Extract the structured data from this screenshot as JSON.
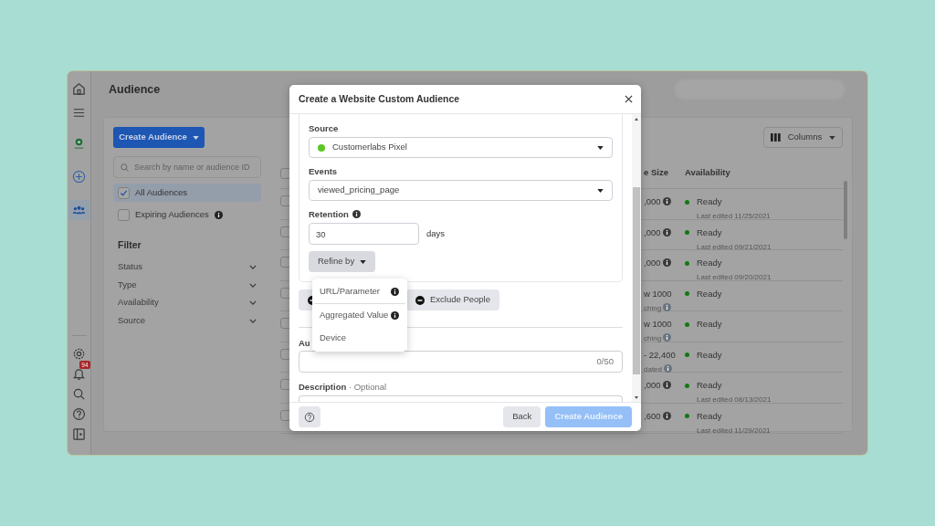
{
  "app": {
    "title": "Audience",
    "rail": {
      "items": [
        {
          "selected": false
        },
        {
          "selected": false
        },
        {
          "selected": false
        },
        {
          "selected": false
        },
        {
          "selected": true
        }
      ],
      "notification_count": "94"
    },
    "create_button": "Create Audience",
    "search": {
      "placeholder": "Search by name or audience ID"
    },
    "views": [
      {
        "label": "All Audiences",
        "selected": true
      },
      {
        "label": "Expiring Audiences",
        "selected": false,
        "info": true
      }
    ],
    "filter": {
      "title": "Filter",
      "items": [
        "Status",
        "Type",
        "Availability",
        "Source"
      ]
    },
    "columns_button": "Columns",
    "table": {
      "select_all": {
        "checked": false
      },
      "columns": [
        "e Size",
        "Availability"
      ],
      "rows": [
        {
          "checked": false,
          "size": ",000",
          "info": true,
          "status": "Ready",
          "edited": "Last edited 11/25/2021"
        },
        {
          "checked": false,
          "size": ",000",
          "info": true,
          "status": "Ready",
          "edited": "Last edited 09/21/2021"
        },
        {
          "checked": false,
          "size": ",000",
          "info": true,
          "status": "Ready",
          "edited": "Last edited 09/20/2021"
        },
        {
          "checked": false,
          "size": "w 1000",
          "note": "ching",
          "info": true,
          "status": "Ready"
        },
        {
          "checked": false,
          "size": "w 1000",
          "note": "ching",
          "info": true,
          "status": "Ready"
        },
        {
          "checked": false,
          "size": "- 22,400",
          "note": "dated",
          "info": true,
          "status": "Ready"
        },
        {
          "checked": false,
          "size": ",000",
          "info": true,
          "status": "Ready",
          "edited": "Last edited 08/13/2021"
        },
        {
          "checked": false,
          "size": ",600",
          "info": true,
          "status": "Ready",
          "edited": "Last edited 11/29/2021"
        }
      ]
    }
  },
  "modal": {
    "title": "Create a Website Custom Audience",
    "source": {
      "label": "Source",
      "value": "Customerlabs Pixel"
    },
    "events": {
      "label": "Events",
      "value": "viewed_pricing_page"
    },
    "retention": {
      "label": "Retention",
      "value": "30",
      "unit": "days"
    },
    "refine_button": "Refine by",
    "refine_menu": [
      {
        "label": "URL/Parameter",
        "info": true
      },
      {
        "label": "Aggregated Value",
        "info": true
      },
      {
        "label": "Device",
        "info": false
      }
    ],
    "exclude_button": "Exclude People",
    "name": {
      "label": "Au",
      "counter": "0/50"
    },
    "description": {
      "label": "Description",
      "optional": "· Optional"
    },
    "back_button": "Back",
    "create_button": {
      "label": "Create Audience",
      "disabled": true
    }
  }
}
